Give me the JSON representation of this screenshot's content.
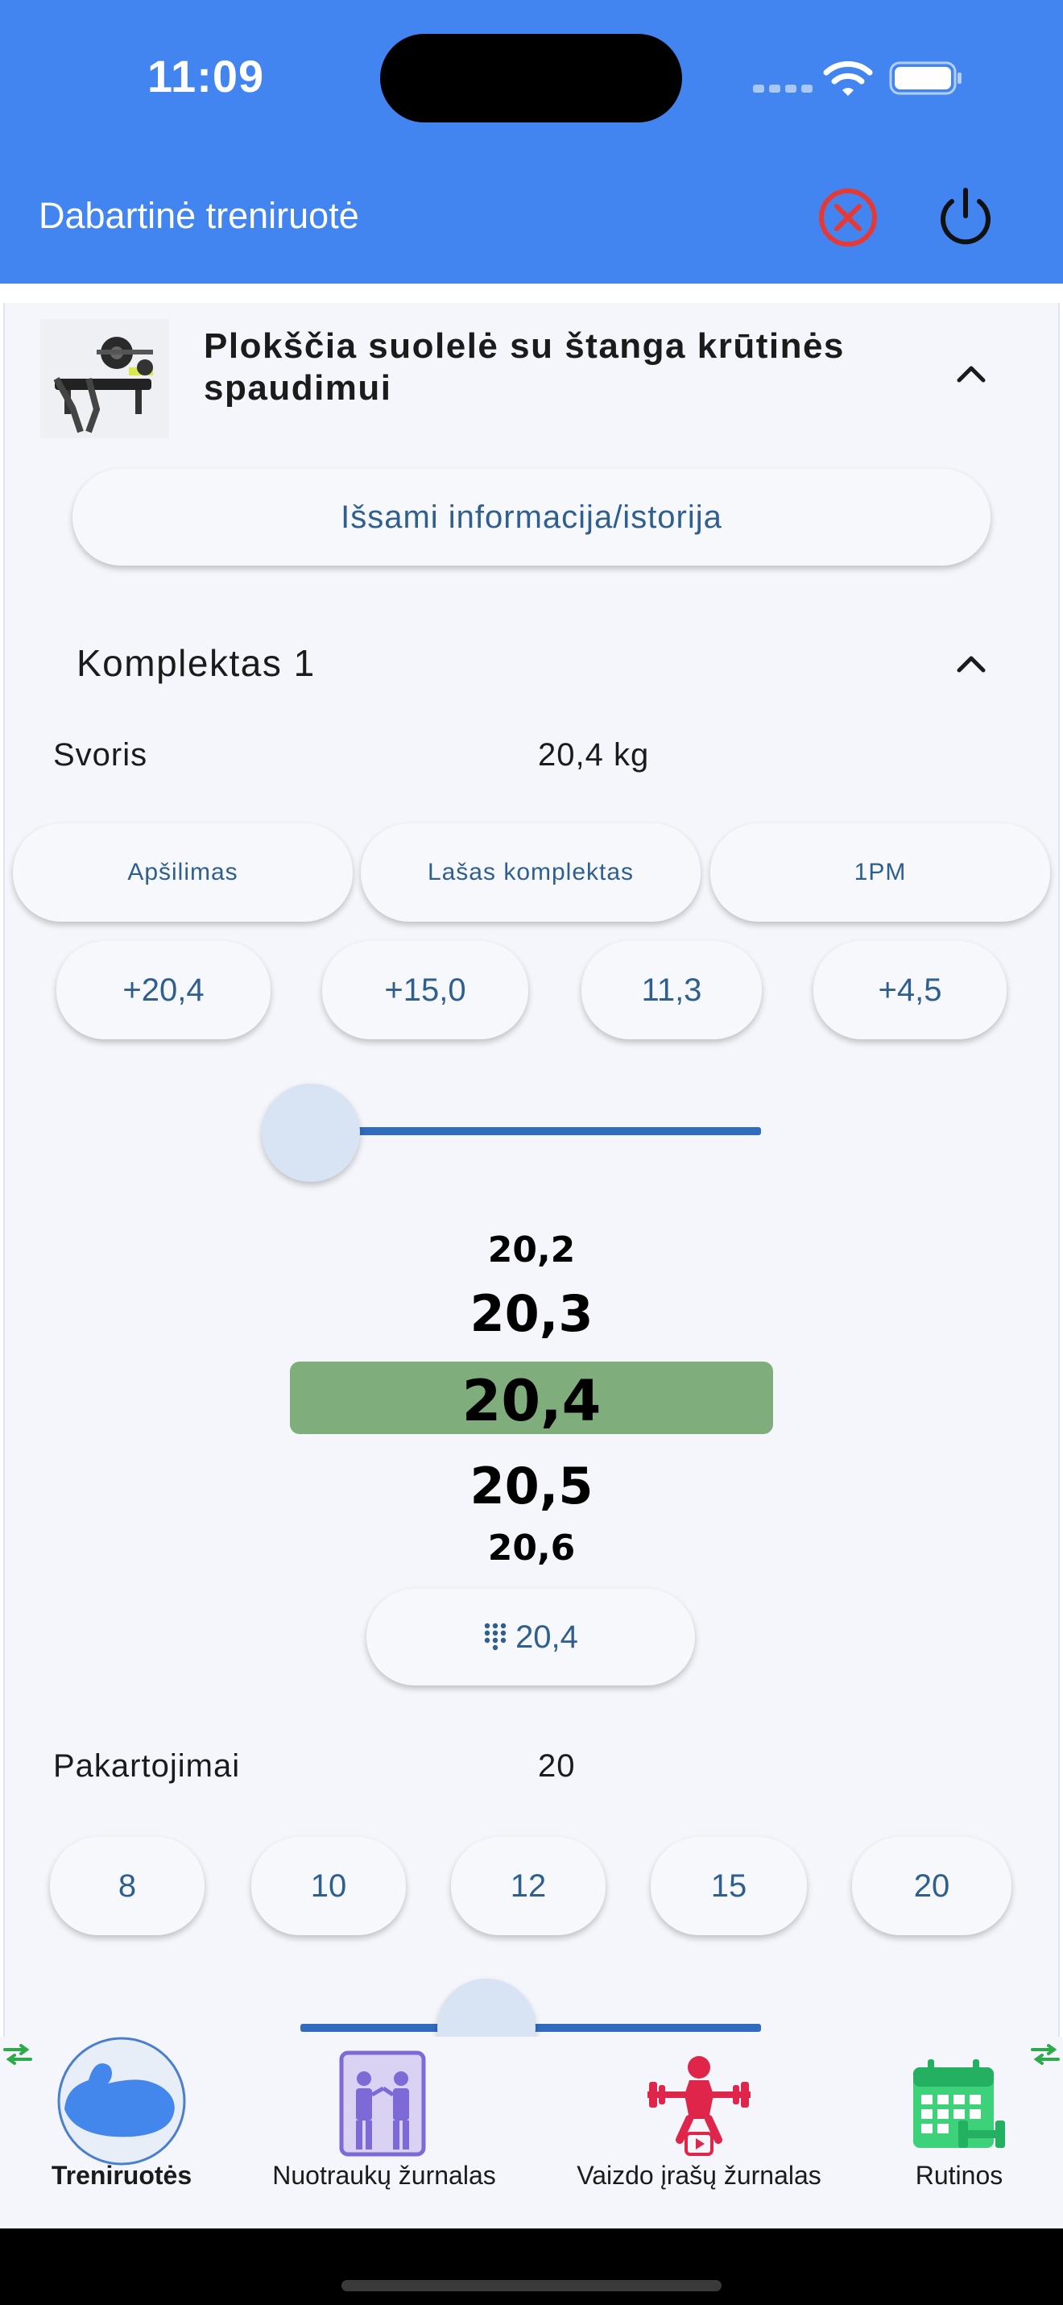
{
  "status_bar": {
    "time": "11:09"
  },
  "header": {
    "title": "Dabartinė treniruotė"
  },
  "exercise": {
    "title": "Plokščia suolelė su štanga krūtinės spaudimui",
    "details_label": "Išsami informacija/istorija"
  },
  "set": {
    "title": "Komplektas 1",
    "weight_label": "Svoris",
    "weight_value": "20,4 kg",
    "modes": [
      "Apšilimas",
      "Lašas komplektas",
      "1PM"
    ],
    "increments": [
      "+20,4",
      "+15,0",
      "11,3",
      "+4,5"
    ],
    "picker": [
      "20,2",
      "20,3",
      "20,4",
      "20,5",
      "20,6"
    ],
    "keypad_value": "20,4",
    "reps_label": "Pakartojimai",
    "reps_value": "20",
    "rep_options": [
      "8",
      "10",
      "12",
      "15",
      "20"
    ]
  },
  "bottom_nav": {
    "items": [
      {
        "label": "Treniruotės",
        "active": true
      },
      {
        "label": "Nuotraukų žurnalas",
        "active": false
      },
      {
        "label": "Vaizdo įrašų žurnalas",
        "active": false
      },
      {
        "label": "Rutinos",
        "active": false
      }
    ]
  },
  "colors": {
    "header_bg": "#4285f0",
    "accent_blue": "#2f6bbf",
    "picker_highlight": "#80ad7c",
    "cancel_red": "#e53935"
  }
}
